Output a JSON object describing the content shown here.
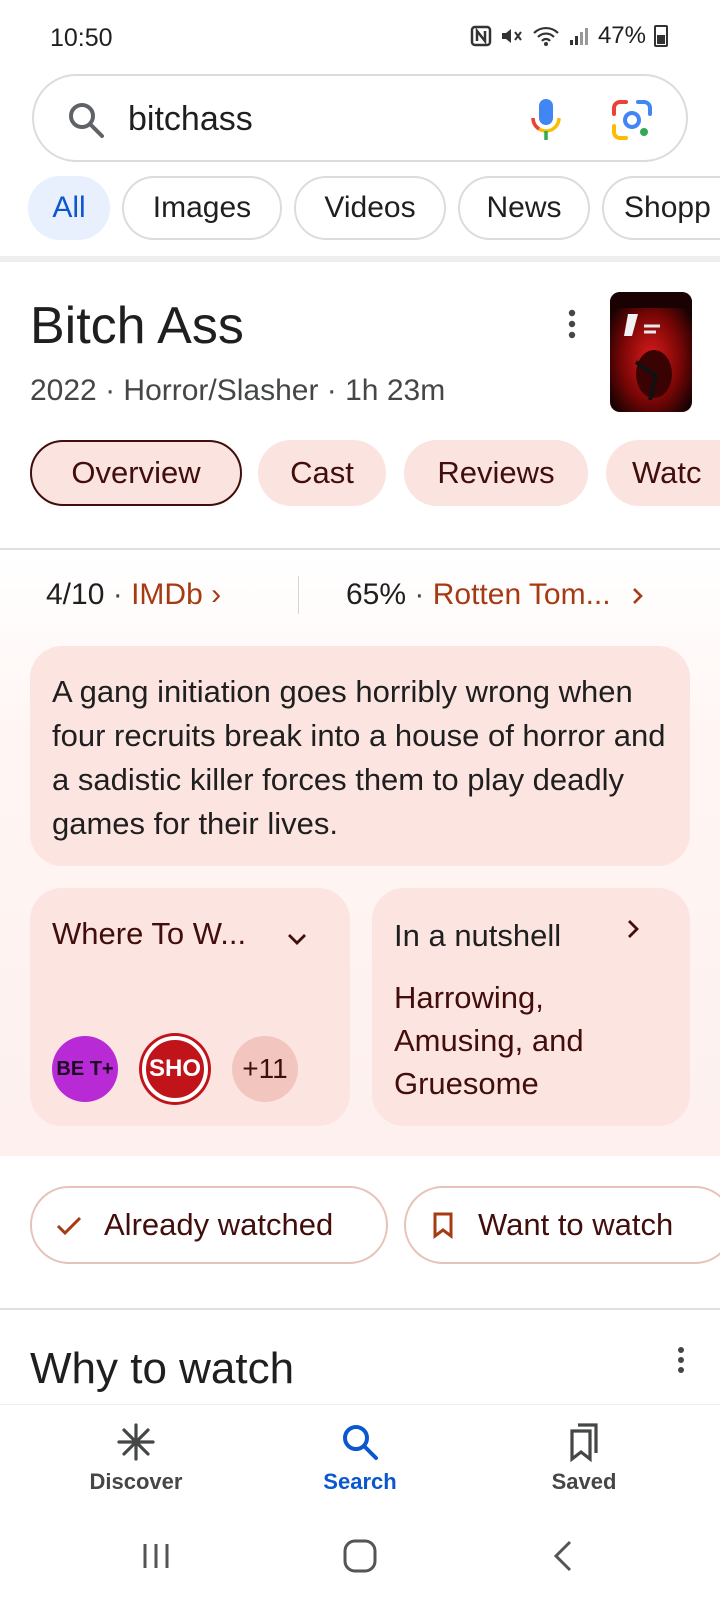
{
  "status_bar": {
    "time": "10:50",
    "battery": "47%",
    "icons": [
      "nfc-icon",
      "mute-icon",
      "wifi-icon",
      "signal-icon",
      "battery-icon"
    ]
  },
  "search": {
    "query": "bitchass",
    "icons": [
      "search-icon",
      "mic-icon",
      "lens-icon"
    ]
  },
  "filters": [
    "All",
    "Images",
    "Videos",
    "News",
    "Shopp"
  ],
  "movie": {
    "title": "Bitch Ass",
    "meta": "2022 · Horror/Slasher · 1h 23m"
  },
  "tabs": [
    "Overview",
    "Cast",
    "Reviews",
    "Watc"
  ],
  "ratings": {
    "imdb_value": "4/10",
    "imdb_source": "IMDb ›",
    "rt_value": "65%",
    "rt_source": "Rotten Tom...",
    "dot": "·"
  },
  "summary": "A gang initiation goes horribly wrong when four recruits break into a house of horror and a sadistic killer forces them to play deadly games for their lives.",
  "where_to_watch": {
    "title": "Where To W...",
    "providers": [
      "BE T+",
      "SHO",
      "+11"
    ]
  },
  "nutshell": {
    "title": "In a nutshell",
    "text": "Harrowing, Amusing, and Gruesome"
  },
  "buttons": {
    "already_watched": "Already watched",
    "want_to_watch": "Want to watch"
  },
  "why_to_watch": "Why to watch",
  "bottom_nav": {
    "discover": "Discover",
    "search": "Search",
    "saved": "Saved"
  },
  "colors": {
    "accent_blue": "#0b57d0",
    "theme_tint": "#fce4e1",
    "theme_text": "#410e0b",
    "link_red": "#a63a13"
  }
}
